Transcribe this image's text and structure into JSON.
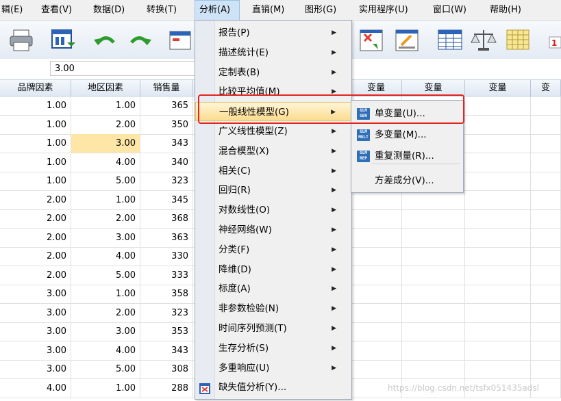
{
  "menubar": {
    "items": [
      "辑(E)",
      "查看(V)",
      "数据(D)",
      "转换(T)",
      "分析(A)",
      "直销(M)",
      "图形(G)",
      "实用程序(U)",
      "窗口(W)",
      "帮助(H)"
    ],
    "active": "分析(A)"
  },
  "toolbar": {
    "icons": [
      "print-icon",
      "dialog-recall-icon",
      "undo-icon",
      "redo-icon",
      "goto-case-icon",
      "select-cases-icon",
      "value-labels-icon",
      "split-file-icon",
      "weight-cases-icon",
      "grid-icon"
    ]
  },
  "editor": {
    "cell_value": "3.00"
  },
  "grid": {
    "columns": [
      "品牌因素",
      "地区因素",
      "销售量",
      "变量",
      "变量",
      "变量",
      "变"
    ],
    "rows": [
      [
        "1.00",
        "1.00",
        "365"
      ],
      [
        "1.00",
        "2.00",
        "350"
      ],
      [
        "1.00",
        "3.00",
        "343"
      ],
      [
        "1.00",
        "4.00",
        "340"
      ],
      [
        "1.00",
        "5.00",
        "323"
      ],
      [
        "2.00",
        "1.00",
        "345"
      ],
      [
        "2.00",
        "2.00",
        "368"
      ],
      [
        "2.00",
        "3.00",
        "363"
      ],
      [
        "2.00",
        "4.00",
        "330"
      ],
      [
        "2.00",
        "5.00",
        "333"
      ],
      [
        "3.00",
        "1.00",
        "358"
      ],
      [
        "3.00",
        "2.00",
        "323"
      ],
      [
        "3.00",
        "3.00",
        "353"
      ],
      [
        "3.00",
        "4.00",
        "343"
      ],
      [
        "3.00",
        "5.00",
        "308"
      ],
      [
        "4.00",
        "1.00",
        "288"
      ]
    ]
  },
  "analyze_menu": {
    "items": [
      {
        "label": "报告(P)",
        "arrow": "▶"
      },
      {
        "label": "描述统计(E)",
        "arrow": "▶"
      },
      {
        "label": "定制表(B)",
        "arrow": "▶"
      },
      {
        "label": "比较平均值(M)",
        "arrow": "▶"
      },
      {
        "label": "一般线性模型(G)",
        "arrow": "▶"
      },
      {
        "label": "广义线性模型(Z)",
        "arrow": "▶"
      },
      {
        "label": "混合模型(X)",
        "arrow": "▶"
      },
      {
        "label": "相关(C)",
        "arrow": "▶"
      },
      {
        "label": "回归(R)",
        "arrow": "▶"
      },
      {
        "label": "对数线性(O)",
        "arrow": "▶"
      },
      {
        "label": "神经网络(W)",
        "arrow": "▶"
      },
      {
        "label": "分类(F)",
        "arrow": "▶"
      },
      {
        "label": "降维(D)",
        "arrow": "▶"
      },
      {
        "label": "标度(A)",
        "arrow": "▶"
      },
      {
        "label": "非参数检验(N)",
        "arrow": "▶"
      },
      {
        "label": "时间序列预测(T)",
        "arrow": "▶"
      },
      {
        "label": "生存分析(S)",
        "arrow": "▶"
      },
      {
        "label": "多重响应(U)",
        "arrow": "▶"
      },
      {
        "label": "缺失值分析(Y)...",
        "arrow": ""
      }
    ]
  },
  "glm_submenu": {
    "items": [
      {
        "label": "单变量(U)...",
        "icon_text": "GLM\nGEN"
      },
      {
        "label": "多变量(M)...",
        "icon_text": "GLM\nMULT"
      },
      {
        "label": "重复测量(R)...",
        "icon_text": "GLM\nREP"
      },
      {
        "label": "方差成分(V)...",
        "icon_text": ""
      }
    ]
  },
  "watermark": "https://blog.csdn.net/tsfx051435adsl",
  "colors": {
    "menu_highlight": "#fbdc8e",
    "selected_cell": "#fde6a6",
    "callout_border": "#e2241e"
  }
}
